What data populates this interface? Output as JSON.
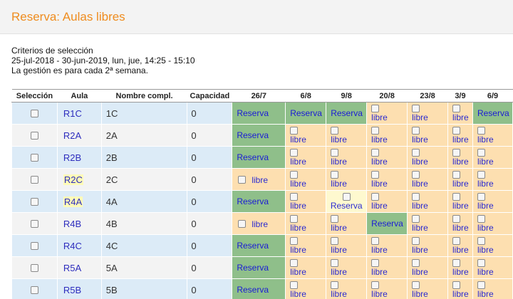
{
  "header": {
    "title": "Reserva: Aulas libres"
  },
  "criteria": {
    "line1": "Criterios de selección",
    "line2": "25-jul-2018 - 30-jun-2019, lun, jue, 14:25 - 15:10",
    "line3": "La gestión es para cada 2ª semana."
  },
  "table": {
    "headers": [
      "Selección",
      "Aula",
      "Nombre compl.",
      "Capacidad",
      "26/7",
      "6/8",
      "9/8",
      "20/8",
      "23/8",
      "3/9",
      "6/9"
    ],
    "labels": {
      "reserva": "Reserva",
      "libre": "libre"
    },
    "rows": [
      {
        "aula": "R1C",
        "nombre": "1C",
        "capacidad": "0",
        "highlight": false,
        "cells": [
          "reserva",
          "reserva",
          "reserva",
          "libre",
          "libre",
          "libre",
          "reserva"
        ]
      },
      {
        "aula": "R2A",
        "nombre": "2A",
        "capacidad": "0",
        "highlight": false,
        "cells": [
          "reserva",
          "libre",
          "libre",
          "libre",
          "libre",
          "libre",
          "libre"
        ]
      },
      {
        "aula": "R2B",
        "nombre": "2B",
        "capacidad": "0",
        "highlight": false,
        "cells": [
          "reserva",
          "libre",
          "libre",
          "libre",
          "libre",
          "libre",
          "libre"
        ]
      },
      {
        "aula": "R2C",
        "nombre": "2C",
        "capacidad": "0",
        "highlight": true,
        "cells": [
          "libre-inline",
          "libre",
          "libre",
          "libre",
          "libre",
          "libre",
          "libre"
        ]
      },
      {
        "aula": "R4A",
        "nombre": "4A",
        "capacidad": "0",
        "highlight": true,
        "cells": [
          "reserva",
          "libre",
          "pending",
          "libre",
          "libre",
          "libre",
          "libre"
        ]
      },
      {
        "aula": "R4B",
        "nombre": "4B",
        "capacidad": "0",
        "highlight": false,
        "cells": [
          "libre-inline",
          "libre",
          "libre",
          "reserva",
          "libre",
          "libre",
          "libre"
        ]
      },
      {
        "aula": "R4C",
        "nombre": "4C",
        "capacidad": "0",
        "highlight": false,
        "cells": [
          "reserva",
          "libre",
          "libre",
          "libre",
          "libre",
          "libre",
          "libre"
        ]
      },
      {
        "aula": "R5A",
        "nombre": "5A",
        "capacidad": "0",
        "highlight": false,
        "cells": [
          "reserva",
          "libre",
          "libre",
          "libre",
          "libre",
          "libre",
          "libre"
        ]
      },
      {
        "aula": "R5B",
        "nombre": "5B",
        "capacidad": "0",
        "highlight": false,
        "cells": [
          "reserva",
          "libre",
          "libre",
          "libre",
          "libre",
          "libre",
          "libre"
        ]
      }
    ]
  },
  "colors": {
    "title": "#ef8c1f",
    "reserva_bg": "#8fbf8a",
    "libre_bg": "#fddfb0",
    "link": "#2d2dbd"
  }
}
